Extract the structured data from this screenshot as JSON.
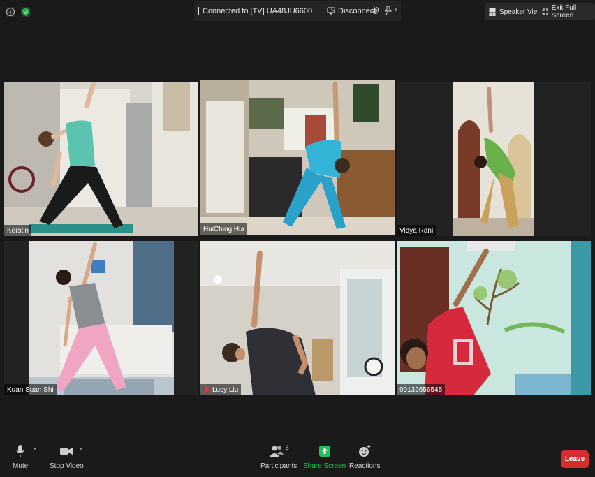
{
  "connection": {
    "status": "Connected to [TV] UA48JU6600",
    "disconnect_label": "Disconnect"
  },
  "top_right": {
    "speaker_view": "Speaker View",
    "exit_full_screen": "Exit Full Screen"
  },
  "participants_tiles": [
    {
      "name": "Kerstin",
      "active": false
    },
    {
      "name": "HuiChing Hia",
      "active": true
    },
    {
      "name": "Vidya Rani",
      "active": false
    },
    {
      "name": "Kuan Suan Shi",
      "active": false
    },
    {
      "name": "Lucy Liu",
      "active": false,
      "muted": true
    },
    {
      "name": "99132656545",
      "active": false
    }
  ],
  "toolbar": {
    "mute_label": "Mute",
    "stop_video_label": "Stop Video",
    "participants_label": "Participants",
    "participants_count": "6",
    "share_screen_label": "Share Screen",
    "reactions_label": "Reactions",
    "leave_label": "Leave"
  },
  "colors": {
    "active_border": "#e6e07a",
    "share_green": "#23c15a",
    "leave_red": "#d42e2e",
    "shield_green": "#22b24c"
  }
}
